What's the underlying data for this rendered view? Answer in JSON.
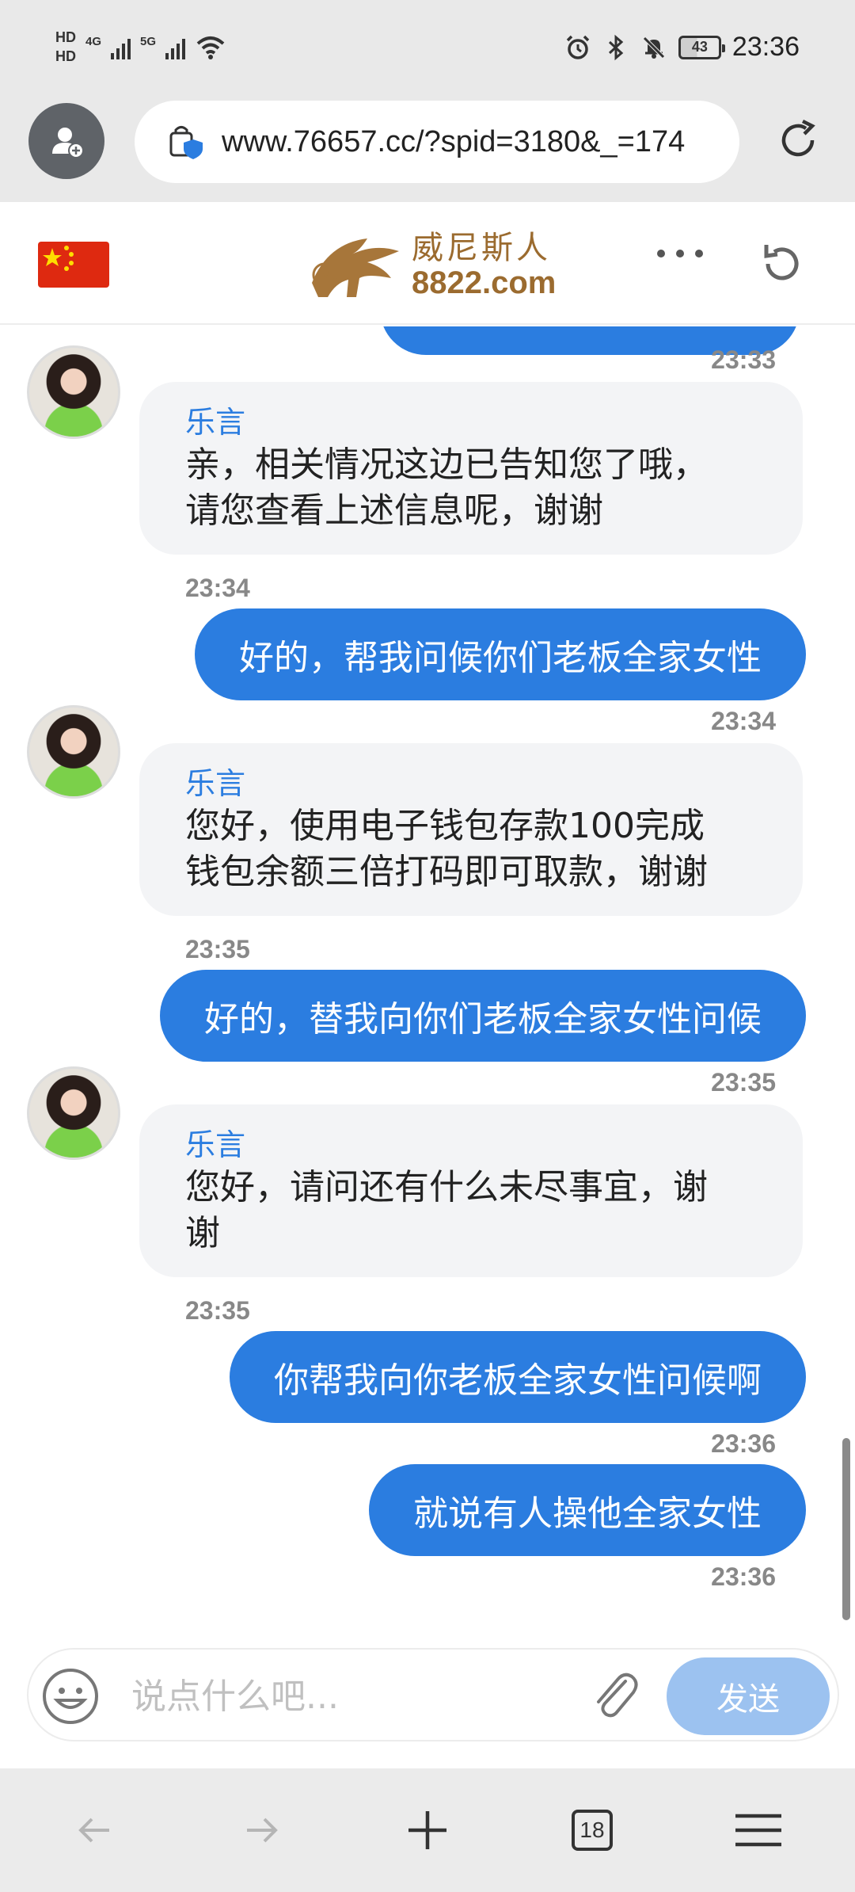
{
  "status_bar": {
    "hd1": "HD",
    "hd2": "HD",
    "net1": "4G",
    "net2": "5G",
    "battery": "43",
    "time": "23:36"
  },
  "browser": {
    "url": "www.76657.cc/?spid=3180&_=174",
    "tabs_count": "18"
  },
  "site": {
    "logo_cn": "威尼斯人",
    "logo_en": "8822.com"
  },
  "chat": {
    "timestamps": {
      "t0": "23:33",
      "t1": "23:34",
      "t2": "23:34",
      "t3": "23:35",
      "t4": "23:35",
      "t5": "23:35",
      "t6": "23:36",
      "t7": "23:36"
    },
    "agent_name": "乐言",
    "messages": [
      {
        "from": "agent",
        "lines": [
          "亲，相关情况这边已告知您了哦，",
          "请您查看上述信息呢，谢谢"
        ]
      },
      {
        "from": "user",
        "text": "好的，帮我问候你们老板全家女性"
      },
      {
        "from": "agent",
        "lines": [
          "您好，使用电子钱包存款100完成",
          "钱包余额三倍打码即可取款，谢谢"
        ]
      },
      {
        "from": "user",
        "text": "好的，替我向你们老板全家女性问候"
      },
      {
        "from": "agent",
        "lines": [
          "您好，请问还有什么未尽事宜，谢",
          "谢"
        ]
      },
      {
        "from": "user",
        "text": "你帮我向你老板全家女性问候啊"
      },
      {
        "from": "user",
        "text": "就说有人操他全家女性"
      }
    ]
  },
  "input": {
    "placeholder": "说点什么吧...",
    "send_label": "发送"
  },
  "colors": {
    "accent": "#2b7de0",
    "send_disabled": "#9cc2f0",
    "bubble_in": "#f3f4f6"
  }
}
